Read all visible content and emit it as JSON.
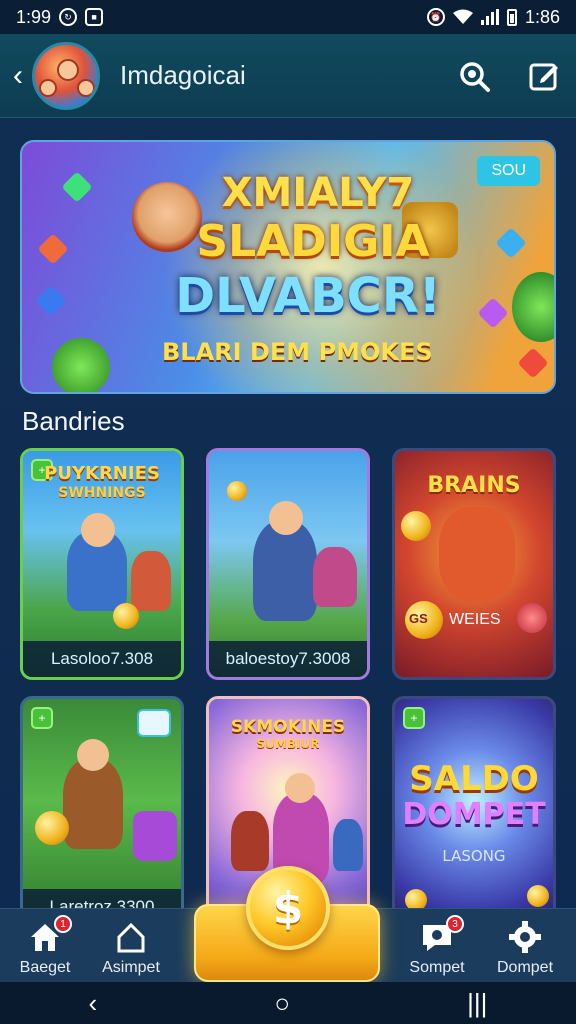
{
  "status_bar": {
    "time_left": "1:99",
    "time_right": "1:86"
  },
  "header": {
    "title": "Imdagoicai",
    "back_icon": "chevron-left-icon",
    "search_icon": "search-icon",
    "edit_icon": "edit-icon"
  },
  "banner": {
    "tag": "SOU",
    "line1": "XMIALY7",
    "line2": "SLADIGIA",
    "line3": "DLVABCR!",
    "subline": "BLARI DEM PMOKES"
  },
  "section": {
    "title": "Bandries"
  },
  "cards": [
    {
      "title": "PUYKRNIES",
      "subtitle": "SWHNINGS",
      "label": "Lasoloo7.308",
      "badge": "+"
    },
    {
      "title": "",
      "subtitle": "",
      "label": "baloestoy7.3008",
      "badge": ""
    },
    {
      "title": "BRAINS",
      "subtitle": "",
      "label": "",
      "chip_left": "GS",
      "chip_right": "WEIES",
      "badge": ""
    },
    {
      "title": "",
      "subtitle": "",
      "label": "Laretroz 3300",
      "badge": "+"
    },
    {
      "title": "SKMOKINES",
      "subtitle": "SUMBIUR",
      "label": "",
      "badge": ""
    },
    {
      "title": "SALDO",
      "subtitle": "DOMPET",
      "label": "LASONG",
      "badge": "+"
    }
  ],
  "bottom_nav": {
    "items": [
      {
        "label": "Baeget",
        "icon": "home-icon",
        "badge": "1"
      },
      {
        "label": "Asimpet",
        "icon": "house-outline-icon",
        "badge": ""
      },
      {
        "label": "Sompet",
        "icon": "chat-icon",
        "badge": "3"
      },
      {
        "label": "Dompet",
        "icon": "gear-icon",
        "badge": ""
      }
    ],
    "center_symbol": "$"
  },
  "colors": {
    "background": "#0e2a4a",
    "header": "#104a5e",
    "accent_gold": "#f5a917"
  }
}
